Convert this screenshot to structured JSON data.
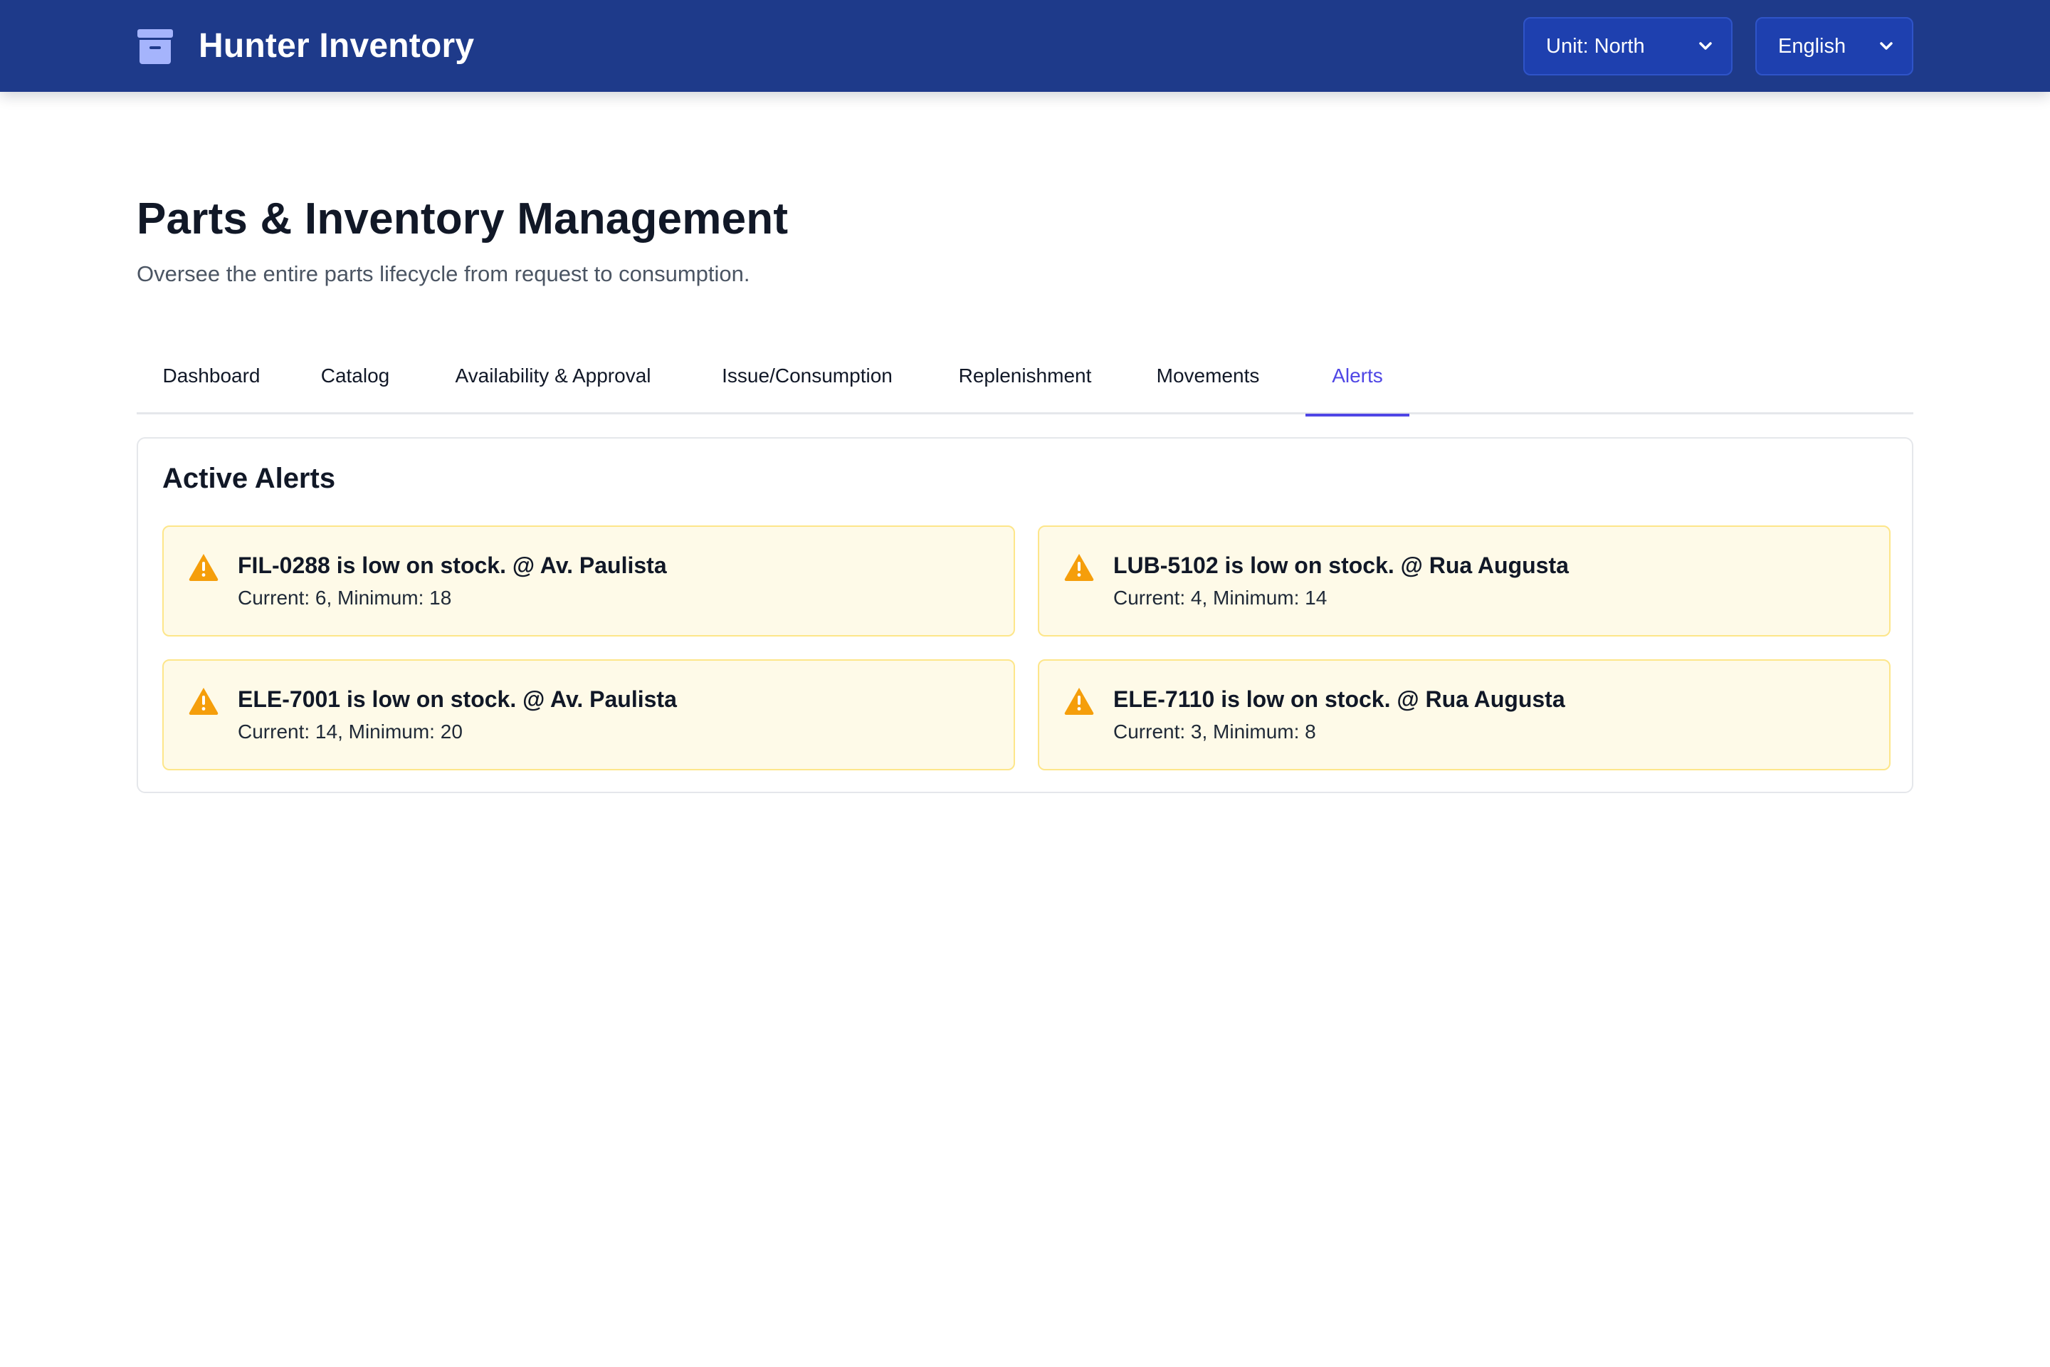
{
  "header": {
    "app_title": "Hunter Inventory",
    "brand_icon": "archive-box-icon",
    "unit_select": {
      "value": "Unit: North"
    },
    "language_select": {
      "value": "English"
    }
  },
  "page": {
    "title": "Parts & Inventory Management",
    "subtitle": "Oversee the entire parts lifecycle from request to consumption."
  },
  "tabs": [
    {
      "label": "Dashboard",
      "active": false
    },
    {
      "label": "Catalog",
      "active": false
    },
    {
      "label": "Availability & Approval",
      "active": false
    },
    {
      "label": "Issue/Consumption",
      "active": false
    },
    {
      "label": "Replenishment",
      "active": false
    },
    {
      "label": "Movements",
      "active": false
    },
    {
      "label": "Alerts",
      "active": true
    }
  ],
  "alerts_section": {
    "title": "Active Alerts",
    "alerts": [
      {
        "title": "FIL-0288 is low on stock. @ Av. Paulista",
        "detail": "Current: 6, Minimum: 18",
        "icon": "warning-triangle-icon"
      },
      {
        "title": "LUB-5102 is low on stock. @ Rua Augusta",
        "detail": "Current: 4, Minimum: 14",
        "icon": "warning-triangle-icon"
      },
      {
        "title": "ELE-7001 is low on stock. @ Av. Paulista",
        "detail": "Current: 14, Minimum: 20",
        "icon": "warning-triangle-icon"
      },
      {
        "title": "ELE-7110 is low on stock. @ Rua Augusta",
        "detail": "Current: 3, Minimum: 8",
        "icon": "warning-triangle-icon"
      }
    ]
  },
  "colors": {
    "header_bg": "#1e3a8a",
    "select_bg": "#1e40af",
    "accent": "#4f46e5",
    "alert_bg": "#fefae8",
    "alert_border": "#fde68a",
    "warning": "#f59e0b"
  }
}
